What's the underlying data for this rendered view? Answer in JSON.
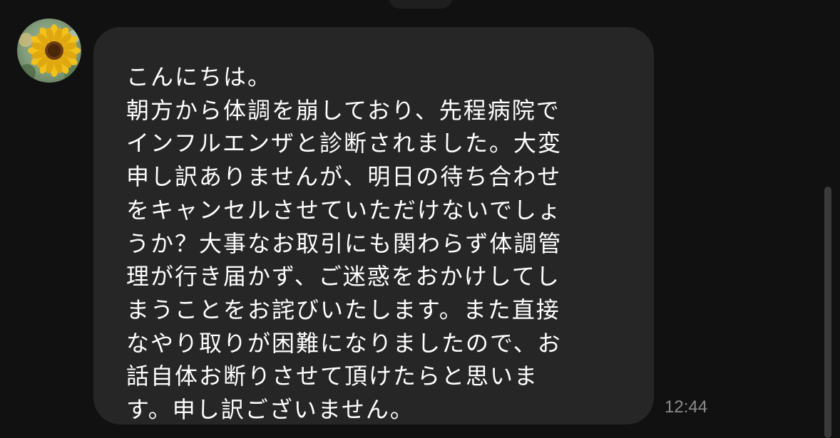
{
  "chat": {
    "message": {
      "lines": [
        "こんにちは。",
        "朝方から体調を崩しており、先程病院で",
        "インフルエンザと診断されました。大変",
        "申し訳ありませんが、明日の待ち合わせ",
        "をキャンセルさせていただけないでしょ",
        "うか？大事なお取引にも関わらず体調管",
        "理が行き届かず、ご迷惑をおかけしてし",
        "まうことをお詫びいたします。また直接",
        "なやり取りが困難になりましたので、お",
        "話自体お断りさせて頂けたらと思いま",
        "す。申し訳ございません。"
      ],
      "timestamp": "12:44"
    },
    "avatar_icon": "sunflower-avatar-icon"
  },
  "colors": {
    "background": "#111111",
    "bubble": "#262626",
    "text": "#ffffff",
    "timestamp": "#8c8c8c"
  }
}
